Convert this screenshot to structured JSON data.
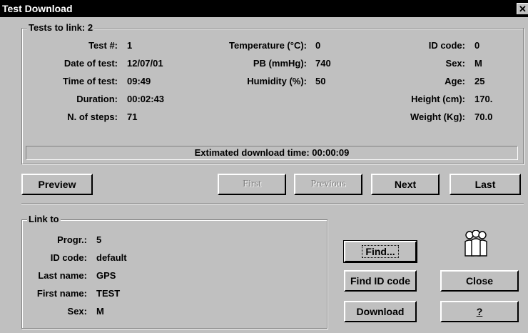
{
  "window": {
    "title": "Test Download",
    "close_glyph": "✕"
  },
  "tests_group": {
    "legend": "Tests to link: 2",
    "col1": [
      {
        "label": "Test #:",
        "value": "1"
      },
      {
        "label": "Date of test:",
        "value": "12/07/01"
      },
      {
        "label": "Time of test:",
        "value": "09:49"
      },
      {
        "label": "Duration:",
        "value": "00:02:43"
      },
      {
        "label": "N. of steps:",
        "value": "71"
      }
    ],
    "col2": [
      {
        "label": "Temperature (°C):",
        "value": "0"
      },
      {
        "label": "PB (mmHg):",
        "value": "740"
      },
      {
        "label": "Humidity (%):",
        "value": "50"
      }
    ],
    "col3": [
      {
        "label": "ID code:",
        "value": "0"
      },
      {
        "label": "Sex:",
        "value": "M"
      },
      {
        "label": "Age:",
        "value": "25"
      },
      {
        "label": "Height (cm):",
        "value": "170."
      },
      {
        "label": "Weight (Kg):",
        "value": "70.0"
      }
    ],
    "estimated": "Extimated download time: 00:00:09"
  },
  "nav": {
    "preview": "Preview",
    "first": "First",
    "previous": "Previous",
    "next": "Next",
    "last": "Last"
  },
  "link_group": {
    "legend": "Link to",
    "fields": [
      {
        "label": "Progr.:",
        "value": "5"
      },
      {
        "label": "ID code:",
        "value": "default"
      },
      {
        "label": "Last name:",
        "value": "GPS"
      },
      {
        "label": "First name:",
        "value": "TEST"
      },
      {
        "label": "Sex:",
        "value": "M"
      }
    ]
  },
  "actions": {
    "find": "Find...",
    "find_id": "Find ID code",
    "download": "Download",
    "close": "Close",
    "help": "?"
  },
  "icons": {
    "people": "people-group-icon"
  },
  "colors": {
    "face": "#c0c0c0",
    "title_bg": "#000000",
    "disabled_text": "#808080"
  }
}
